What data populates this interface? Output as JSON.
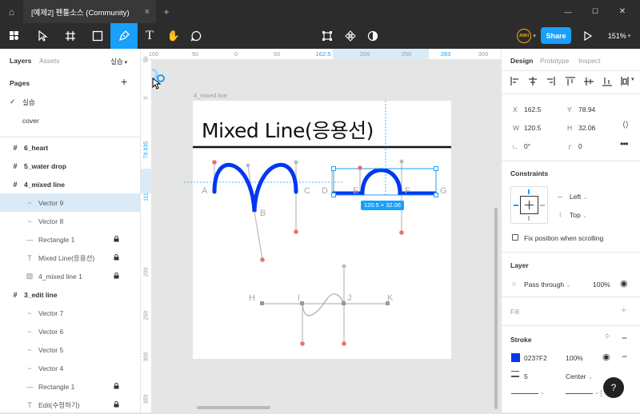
{
  "titlebar": {
    "home_icon": "home-icon",
    "tab_title": "[예제2] 펜툴소스 (Community)",
    "close": "×",
    "new": "+",
    "min": "—",
    "max": "☐",
    "xclose": "✕"
  },
  "toolbar": {
    "zoom": "151%",
    "share": "Share",
    "avatar_text": "ANKI"
  },
  "left": {
    "tab_layers": "Layers",
    "tab_assets": "Assets",
    "page_name": "실습",
    "pages_header": "Pages",
    "pages": [
      "실습",
      "cover"
    ],
    "layers": [
      {
        "name": "6_heart",
        "type": "frame"
      },
      {
        "name": "5_water drop",
        "type": "frame"
      },
      {
        "name": "4_mixed line",
        "type": "frame"
      },
      {
        "name": "Vector 9",
        "type": "vector"
      },
      {
        "name": "Vector 8",
        "type": "vector"
      },
      {
        "name": "Rectangle 1",
        "type": "rect",
        "lock": true
      },
      {
        "name": "Mixed Line(응용선)",
        "type": "text",
        "lock": true
      },
      {
        "name": "4_mixed line 1",
        "type": "image",
        "lock": true
      },
      {
        "name": "3_edit line",
        "type": "frame"
      },
      {
        "name": "Vector 7",
        "type": "vector"
      },
      {
        "name": "Vector 6",
        "type": "vector"
      },
      {
        "name": "Vector 5",
        "type": "vector"
      },
      {
        "name": "Vector 4",
        "type": "vector"
      },
      {
        "name": "Rectangle 1",
        "type": "rect",
        "lock": true
      },
      {
        "name": "Edit(수정하기)",
        "type": "text",
        "lock": true
      }
    ]
  },
  "rulers": {
    "top": [
      "100",
      "50",
      "0",
      "50",
      "162.5",
      "200",
      "250",
      "283",
      "300"
    ],
    "left": [
      "0",
      "50",
      "78.935",
      "111",
      "200",
      "250",
      "300",
      "350"
    ]
  },
  "canvas": {
    "frame_label": "4_mixed line",
    "heading": "Mixed Line(응용선)",
    "size_badge": "120.5 × 32.06",
    "point_labels": [
      "A",
      "B",
      "C",
      "D",
      "E",
      "F",
      "G",
      "H",
      "I",
      "J",
      "K"
    ]
  },
  "right": {
    "tab_design": "Design",
    "tab_prototype": "Prototype",
    "tab_inspect": "Inspect",
    "x_label": "X",
    "x": "162.5",
    "y_label": "Y",
    "y": "78.94",
    "w_label": "W",
    "w": "120.5",
    "h_label": "H",
    "h": "32.06",
    "rot": "0°",
    "radius": "0",
    "constraints_title": "Constraints",
    "constraint_h": "Left",
    "constraint_v": "Top",
    "fix_position": "Fix position when scrolling",
    "layer_title": "Layer",
    "blend": "Pass through",
    "opacity": "100%",
    "fill_title": "Fill",
    "stroke_title": "Stroke",
    "stroke_color": "0237F2",
    "stroke_opacity": "100%",
    "stroke_weight": "5",
    "stroke_align": "Center",
    "help": "?"
  },
  "colors": {
    "accent": "#18a0fb",
    "stroke_blue": "#0237f2",
    "dark": "#2c2c2c"
  }
}
